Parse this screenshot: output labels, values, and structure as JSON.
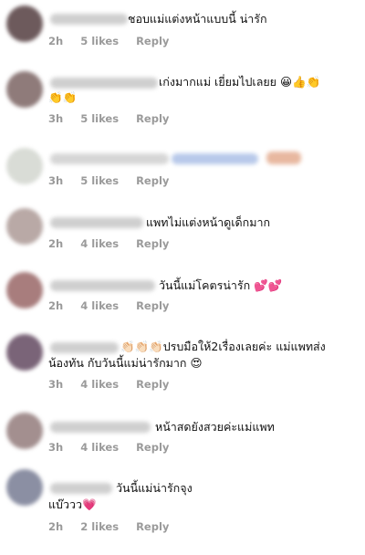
{
  "comments": [
    {
      "text": "ชอบแม่แต่งหน้าแบบนี้ น่ารัก",
      "text2": "",
      "time": "2h",
      "likes": "5 likes",
      "reply": "Reply",
      "avatar_color": "#6d5a5c"
    },
    {
      "text": "เก่งมากแม่ เยี่ยมไปเลยย 😀👍👏",
      "text2": "👏👏",
      "time": "3h",
      "likes": "5 likes",
      "reply": "Reply",
      "avatar_color": "#8f7b7a"
    },
    {
      "text": "",
      "text2": "",
      "time": "3h",
      "likes": "5 likes",
      "reply": "Reply",
      "avatar_color": "#d9dcd6"
    },
    {
      "text": "แพทไม่แต่งหน้าดูเด็กมาก",
      "text2": "",
      "time": "2h",
      "likes": "4 likes",
      "reply": "Reply",
      "avatar_color": "#b9a9a6"
    },
    {
      "text": "วันนี้แม่โคตรน่ารัก 💕💕",
      "text2": "",
      "time": "2h",
      "likes": "4 likes",
      "reply": "Reply",
      "avatar_color": "#a87d7d"
    },
    {
      "text": "👏🏻👏🏻👏🏻ปรบมือให้2เรื่องเลยค่ะ แม่แพทส่ง",
      "text2": "น้องทัน กับวันนี้แม่น่ารักมาก 😍",
      "time": "3h",
      "likes": "4 likes",
      "reply": "Reply",
      "avatar_color": "#7a6478"
    },
    {
      "text": "หน้าสดยังสวยค่ะแม่แพท",
      "text2": "",
      "time": "3h",
      "likes": "4 likes",
      "reply": "Reply",
      "avatar_color": "#a38f8f"
    },
    {
      "text": "วันนี้แม่น่ารักจุง",
      "text2": "แบ๊ววว💗",
      "time": "2h",
      "likes": "2 likes",
      "reply": "Reply",
      "avatar_color": "#8b8fa3"
    }
  ]
}
